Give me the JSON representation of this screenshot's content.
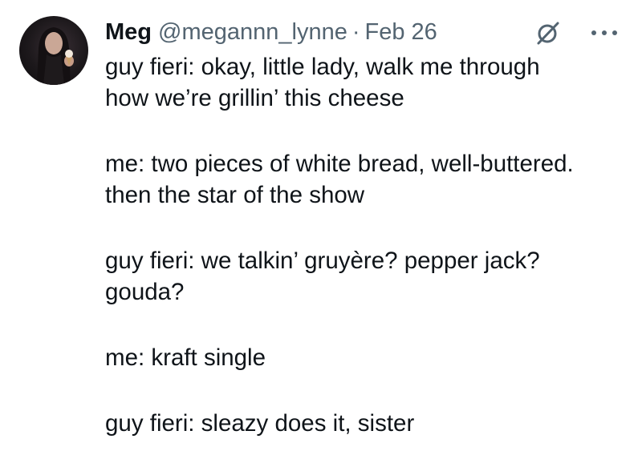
{
  "tweet": {
    "author": {
      "name": "Meg",
      "handle": "@megannn_lynne",
      "avatar_icon": "profile-photo"
    },
    "separator": "·",
    "date": "Feb 26",
    "icons": {
      "grok": "grok-icon",
      "more": "more-options-icon"
    },
    "paragraphs": [
      {
        "lines": [
          "guy fieri: okay, little lady, walk me through",
          "how we’re grillin’ this cheese"
        ]
      },
      {
        "lines": [
          "me: two pieces of white bread, well-buttered.",
          "then the star of the show"
        ]
      },
      {
        "lines": [
          "guy fieri: we talkin’ gruyère? pepper jack?",
          "gouda?"
        ]
      },
      {
        "lines": [
          "me: kraft single"
        ]
      },
      {
        "lines": [
          "guy fieri: sleazy does it, sister"
        ]
      }
    ]
  }
}
